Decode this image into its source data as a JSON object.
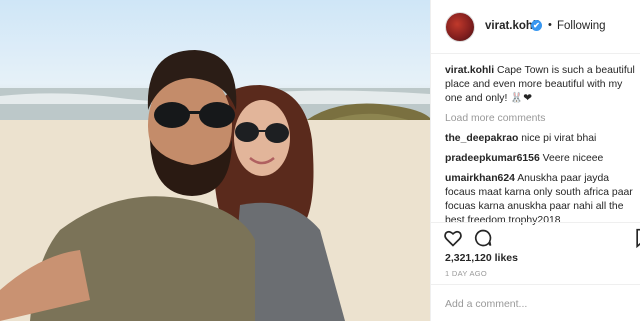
{
  "post": {
    "username": "virat.kohli",
    "verified_mark": "✔",
    "separator": "•",
    "follow_status": "Following",
    "caption_user": "virat.kohli",
    "caption_text": "Cape Town is such a beautiful place and even more beautiful with my one and only! 🐰❤",
    "load_more": "Load more comments",
    "comments": [
      {
        "user": "the_deepakrao",
        "text": "nice pi virat bhai"
      },
      {
        "user": "pradeepkumar6156",
        "text": "Veere niceee"
      },
      {
        "user": "umairkhan624",
        "text": "Anuskha paar jayda focaus maat karna only south africa paar focuas karna anuskha paar nahi all the best freedom trophy2018"
      }
    ],
    "likes": "2,321,120 likes",
    "time_ago": "1 DAY AGO",
    "add_comment_placeholder": "Add a comment..."
  },
  "icons": {
    "like": "heart-icon",
    "comment": "comment-icon",
    "save": "bookmark-icon",
    "verified": "verified-badge-icon"
  },
  "colors": {
    "link_blue": "#3897f0",
    "text": "#262626",
    "muted": "#999999",
    "border": "#efefef"
  }
}
